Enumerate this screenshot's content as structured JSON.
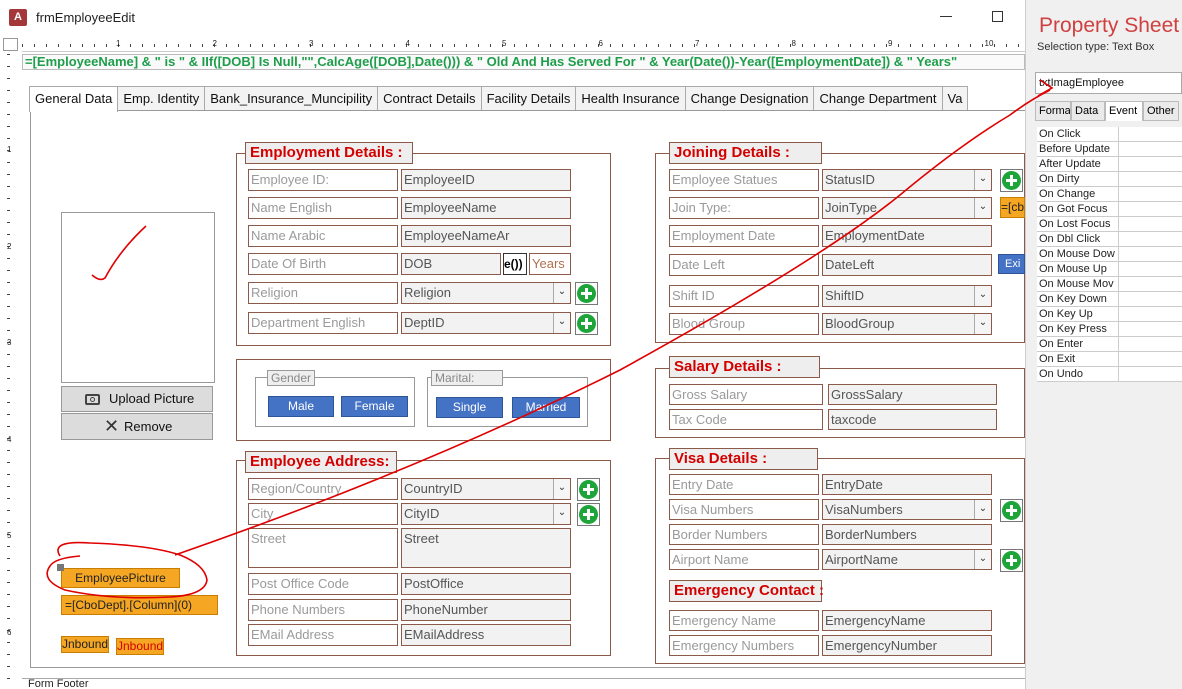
{
  "window": {
    "title": "frmEmployeeEdit",
    "app_icon": "A"
  },
  "ruler": {
    "marks": [
      "1",
      "2",
      "3",
      "4",
      "5",
      "6",
      "7",
      "8",
      "9",
      "10"
    ],
    "vmarks": [
      "1",
      "2",
      "3",
      "4",
      "5",
      "6"
    ]
  },
  "expression": "=[EmployeeName] & \" is \" & IIf([DOB] Is Null,\"\",CalcAge([DOB],Date())) & \" Old And Has Served For \" & Year(Date())-Year([EmploymentDate]) & \" Years\"",
  "tabs": [
    "General Data",
    "Emp. Identity",
    "Bank_Insurance_Muncipility",
    "Contract Details",
    "Facility Details",
    "Health Insurance",
    "Change Designation",
    "Change Department",
    "Va"
  ],
  "employment": {
    "title": "Employment Details :",
    "rows": [
      {
        "label": "Employee ID:",
        "field": "EmployeeID"
      },
      {
        "label": "Name English",
        "field": "EmployeeName"
      },
      {
        "label": "Name Arabic",
        "field": "EmployeeNameAr"
      },
      {
        "label": "Date Of Birth",
        "field": "DOB",
        "extra": "e())",
        "years": "Years"
      },
      {
        "label": "Religion",
        "field": "Religion"
      },
      {
        "label": "Department English",
        "field": "DeptID"
      }
    ]
  },
  "gender": {
    "label": "Gender",
    "male": "Male",
    "female": "Female"
  },
  "marital": {
    "label": "Marital:",
    "single": "Single",
    "married": "Married"
  },
  "address": {
    "title": "Employee Address:",
    "rows": [
      {
        "label": "Region/Country",
        "field": "CountryID"
      },
      {
        "label": "City",
        "field": "CityID"
      },
      {
        "label": "Street",
        "field": "Street"
      },
      {
        "label": "Post Office Code",
        "field": "PostOffice"
      },
      {
        "label": "Phone Numbers",
        "field": "PhoneNumber"
      },
      {
        "label": "EMail Address",
        "field": "EMailAddress"
      }
    ]
  },
  "joining": {
    "title": "Joining Details  :",
    "rows": [
      {
        "label": "Employee Statues",
        "field": "StatusID",
        "side": "=[cb"
      },
      {
        "label": "Join Type:",
        "field": "JoinType"
      },
      {
        "label": "Employment Date",
        "field": "EmploymentDate"
      },
      {
        "label": "Date Left",
        "field": "DateLeft",
        "side": "Exi"
      },
      {
        "label": "Shift ID",
        "field": "ShiftID"
      },
      {
        "label": "Blood Group",
        "field": "BloodGroup"
      }
    ]
  },
  "salary": {
    "title": "Salary Details :",
    "rows": [
      {
        "label": "Gross Salary",
        "field": "GrossSalary"
      },
      {
        "label": "Tax Code",
        "field": "taxcode"
      }
    ]
  },
  "visa": {
    "title": "Visa Details :",
    "rows": [
      {
        "label": "Entry Date",
        "field": "EntryDate"
      },
      {
        "label": "Visa Numbers",
        "field": "VisaNumbers"
      },
      {
        "label": "Border Numbers",
        "field": "BorderNumbers"
      },
      {
        "label": "Airport Name",
        "field": "AirportName"
      }
    ]
  },
  "emergency": {
    "title": "Emergency Contact :",
    "rows": [
      {
        "label": "Emergency Name",
        "field": "EmergencyName"
      },
      {
        "label": "Emergency Numbers",
        "field": "EmergencyNumber"
      }
    ]
  },
  "picture": {
    "upload": "Upload Picture",
    "remove": "Remove"
  },
  "orange": {
    "employee_picture": "EmployeePicture",
    "cbo_dept": "=[CboDept].[Column](0)",
    "unbound1": "Jnbound",
    "unbound2": "Jnbound"
  },
  "footer": "Form Footer",
  "property_sheet": {
    "title": "Property Sheet",
    "selection_type": "Selection type:  Text Box",
    "selected_control": "txtImagEmployee",
    "tabs": [
      "Forma",
      "Data",
      "Event",
      "Other"
    ],
    "active_tab": "Event",
    "events": [
      "On Click",
      "Before Update",
      "After Update",
      "On Dirty",
      "On Change",
      "On Got Focus",
      "On Lost Focus",
      "On Dbl Click",
      "On Mouse Dow",
      "On Mouse Up",
      "On Mouse Mov",
      "On Key Down",
      "On Key Up",
      "On Key Press",
      "On Enter",
      "On Exit",
      "On Undo"
    ]
  },
  "colors": {
    "section_title": "#d40000",
    "annotation": "#e00000",
    "expression": "#1e9e4a",
    "accent_orange": "#f5a623",
    "button_blue": "#4472c4"
  }
}
